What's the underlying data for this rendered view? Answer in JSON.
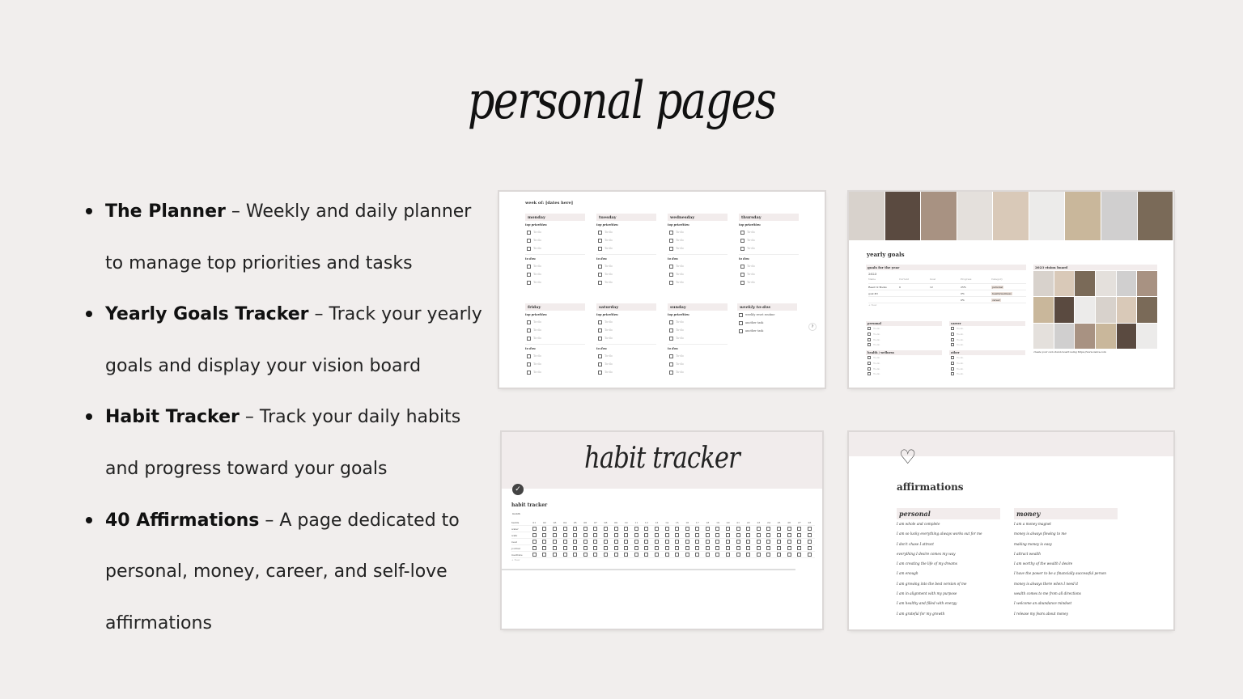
{
  "title": "personal pages",
  "bullets": [
    {
      "name": "The Planner",
      "desc": "Weekly and daily planner to manage top priorities and tasks"
    },
    {
      "name": "Yearly Goals Tracker",
      "desc": "Track your yearly goals and display your vision board"
    },
    {
      "name": "Habit Tracker",
      "desc": "Track your daily habits and progress toward your goals"
    },
    {
      "name": "40 Affirmations",
      "desc": "A page dedicated to personal, money, career, and self-love affirmations"
    }
  ],
  "separator": "–",
  "planner": {
    "week_label": "week of: [dates here]",
    "days": [
      "monday",
      "tuesday",
      "wednesday",
      "thursday",
      "friday",
      "saturday",
      "sunday"
    ],
    "top_priorities": "top priorities:",
    "to_dos": "to dos:",
    "todo": "To-do",
    "weekly_heading": "weekly to-dos",
    "weekly_items": [
      "weekly reset routine",
      "another task",
      "another task"
    ],
    "help": "?"
  },
  "goals": {
    "title": "yearly goals",
    "table_heading": "goals for the year",
    "view": "2023",
    "columns": [
      "Name",
      "Current",
      "Goal",
      "Progress",
      "Category"
    ],
    "rows": [
      {
        "name": "Read 12 Books",
        "current": "0",
        "goal": "12",
        "progress": "25%",
        "category": "personal"
      },
      {
        "name": "goal #2",
        "current": "",
        "goal": "",
        "progress": "0%",
        "category": "health/wellness"
      },
      {
        "name": "",
        "current": "",
        "goal": "",
        "progress": "0%",
        "category": "career"
      }
    ],
    "new": "+ New",
    "vision_heading": "2023 vision board",
    "vision_caption": "create your own vision board using https://www.canva.com",
    "lists": [
      "personal",
      "career",
      "health / wellness",
      "other"
    ],
    "todo": "To-do"
  },
  "habit": {
    "banner": "habit tracker",
    "title": "habit tracker",
    "view": "month",
    "habits_col": "habits",
    "habits": [
      "water",
      "walk",
      "read",
      "journal",
      "meditate"
    ],
    "days": [
      "01",
      "02",
      "03",
      "04",
      "05",
      "06",
      "07",
      "08",
      "09",
      "10",
      "11",
      "12",
      "13",
      "14",
      "15",
      "16",
      "17",
      "18",
      "19",
      "20",
      "21",
      "22",
      "23",
      "24",
      "25",
      "26",
      "27",
      "28"
    ],
    "new": "+ New"
  },
  "affirmations": {
    "title": "affirmations",
    "personal_heading": "personal",
    "personal": [
      "I am whole and complete",
      "I am so lucky everything always works out for me",
      "I don't chase I attract",
      "everything I desire comes my way",
      "I am creating the life of my dreams",
      "I am enough",
      "I am growing into the best version of me",
      "I am in alignment with my purpose",
      "I am healthy and filled with energy",
      "I am grateful for my growth"
    ],
    "money_heading": "money",
    "money": [
      "I am a money magnet",
      "money is always flowing to me",
      "making money is easy",
      "I attract wealth",
      "I am worthy of the wealth I desire",
      "I have the power to be a financially successful person",
      "money is always there when I need it",
      "wealth comes to me from all directions",
      "I welcome an abundance mindset",
      "I release my fears about money"
    ]
  }
}
